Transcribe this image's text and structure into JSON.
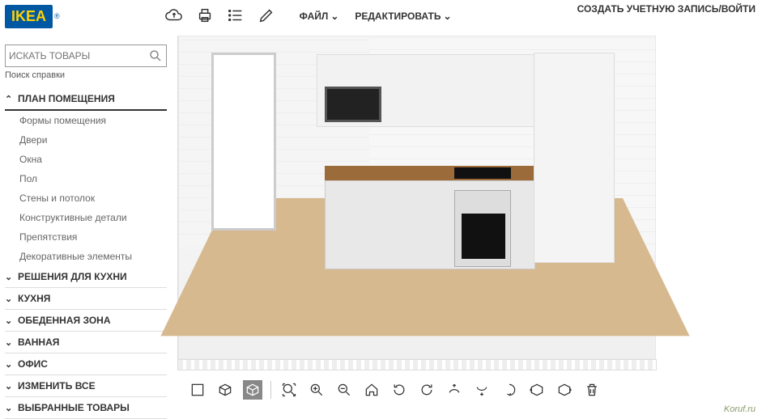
{
  "header": {
    "logo_text": "IKEA",
    "account": "СОЗДАТЬ УЧЕТНУЮ ЗАПИСЬ/ВОЙТИ",
    "menus": {
      "file": "ФАЙЛ",
      "edit": "РЕДАКТИРОВАТЬ"
    }
  },
  "search": {
    "placeholder": "ИСКАТЬ ТОВАРЫ"
  },
  "help": "Поиск справки",
  "sidebar": {
    "cat_room": "ПЛАН ПОМЕЩЕНИЯ",
    "room_items": [
      "Формы помещения",
      "Двери",
      "Окна",
      "Пол",
      "Стены и потолок",
      "Конструктивные детали",
      "Препятствия",
      "Декоративные элементы"
    ],
    "cats": [
      "РЕШЕНИЯ ДЛЯ КУХНИ",
      "КУХНЯ",
      "ОБЕДЕННАЯ ЗОНА",
      "ВАННАЯ",
      "ОФИС",
      "ИЗМЕНИТЬ ВСЕ",
      "ВЫБРАННЫЕ ТОВАРЫ"
    ]
  },
  "watermark": "Koruf.ru"
}
